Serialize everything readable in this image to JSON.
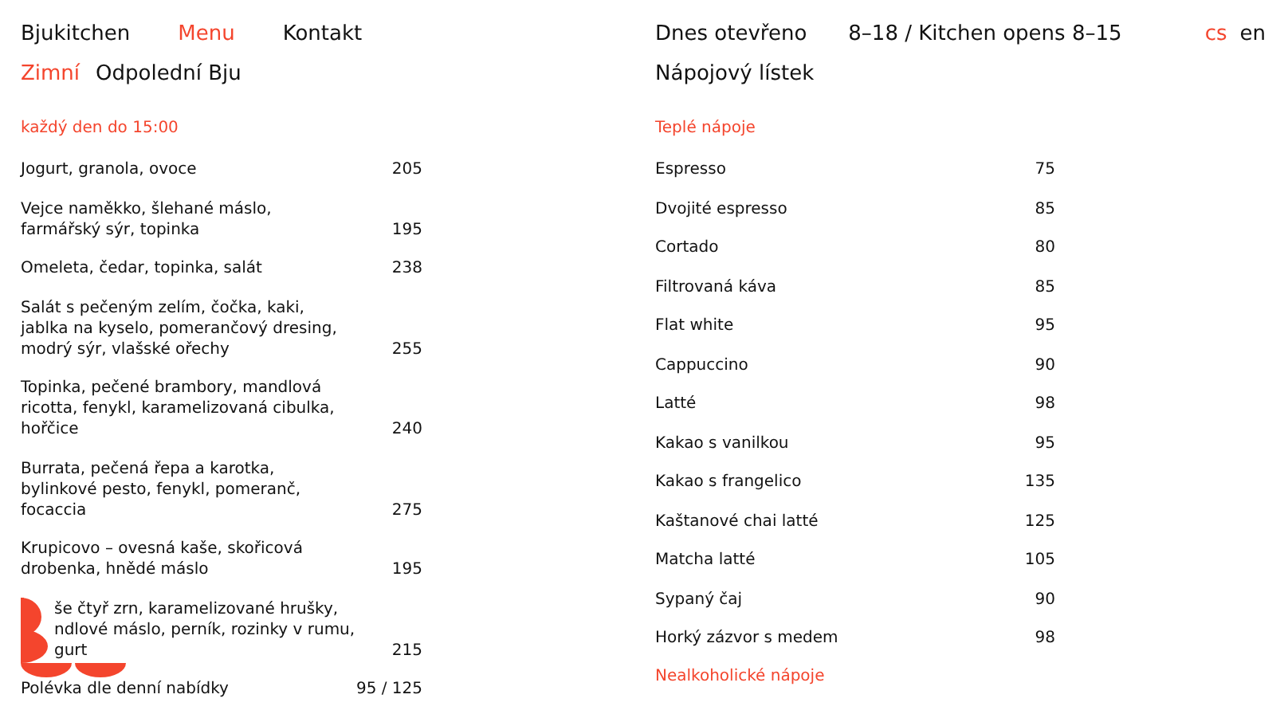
{
  "nav": [
    {
      "label": "Bjukitchen",
      "selected": false
    },
    {
      "label": "Menu",
      "selected": true
    },
    {
      "label": "Kontakt",
      "selected": false
    }
  ],
  "tabs": [
    {
      "label": "Zimní",
      "selected": true
    },
    {
      "label": "Odpolední Bju",
      "selected": false
    }
  ],
  "opening": {
    "label": "Dnes otevřeno",
    "hours": "8–18 / Kitchen opens 8–15"
  },
  "languages": [
    {
      "label": "cs",
      "selected": true
    },
    {
      "label": "en",
      "selected": false
    }
  ],
  "food": {
    "note": "každý den do 15:00",
    "items": [
      {
        "name": "Jogurt, granola, ovoce",
        "price": "205"
      },
      {
        "name": "Vejce naměkko, šlehané máslo, farmářský sýr, topinka",
        "price": "195"
      },
      {
        "name": "Omeleta, čedar, topinka, salát",
        "price": "238"
      },
      {
        "name": "Salát s pečeným zelím, čočka, kaki, jablka na kyselo, pomerančový dresing, modrý sýr, vlašské ořechy",
        "price": "255"
      },
      {
        "name": "Topinka, pečené brambory, mandlová ricotta, fenykl, karamelizovaná cibulka, hořčice",
        "price": "240"
      },
      {
        "name": "Burrata, pečená řepa a karotka, bylinkové pesto, fenykl, pomeranč, focaccia",
        "price": "275"
      },
      {
        "name": "Krupicovo – ovesná kaše, skořicová drobenka, hnědé máslo",
        "price": "195"
      },
      {
        "name": "še čtyř zrn, karamelizované hrušky, ndlové máslo, perník, rozinky v rumu, gurt",
        "price": "215",
        "kind": "covered"
      },
      {
        "name": "Polévka dle denní nabídky",
        "price": "95 / 125"
      }
    ]
  },
  "drinks": {
    "title": "Nápojový lístek",
    "sections": [
      {
        "heading": "Teplé nápoje",
        "items": [
          {
            "name": "Espresso",
            "price": "75"
          },
          {
            "name": "Dvojité espresso",
            "price": "85"
          },
          {
            "name": "Cortado",
            "price": "80"
          },
          {
            "name": "Filtrovaná káva",
            "price": "85"
          },
          {
            "name": "Flat white",
            "price": "95"
          },
          {
            "name": "Cappuccino",
            "price": "90"
          },
          {
            "name": "Latté",
            "price": "98"
          },
          {
            "name": "Kakao s vanilkou",
            "price": "95"
          },
          {
            "name": "Kakao s frangelico",
            "price": "135"
          },
          {
            "name": "Kaštanové chai latté",
            "price": "125"
          },
          {
            "name": "Matcha latté",
            "price": "105"
          },
          {
            "name": "Sypaný čaj",
            "price": "90"
          },
          {
            "name": "Horký zázvor s medem",
            "price": "98"
          }
        ]
      },
      {
        "heading": "Nealkoholické nápoje"
      }
    ]
  }
}
